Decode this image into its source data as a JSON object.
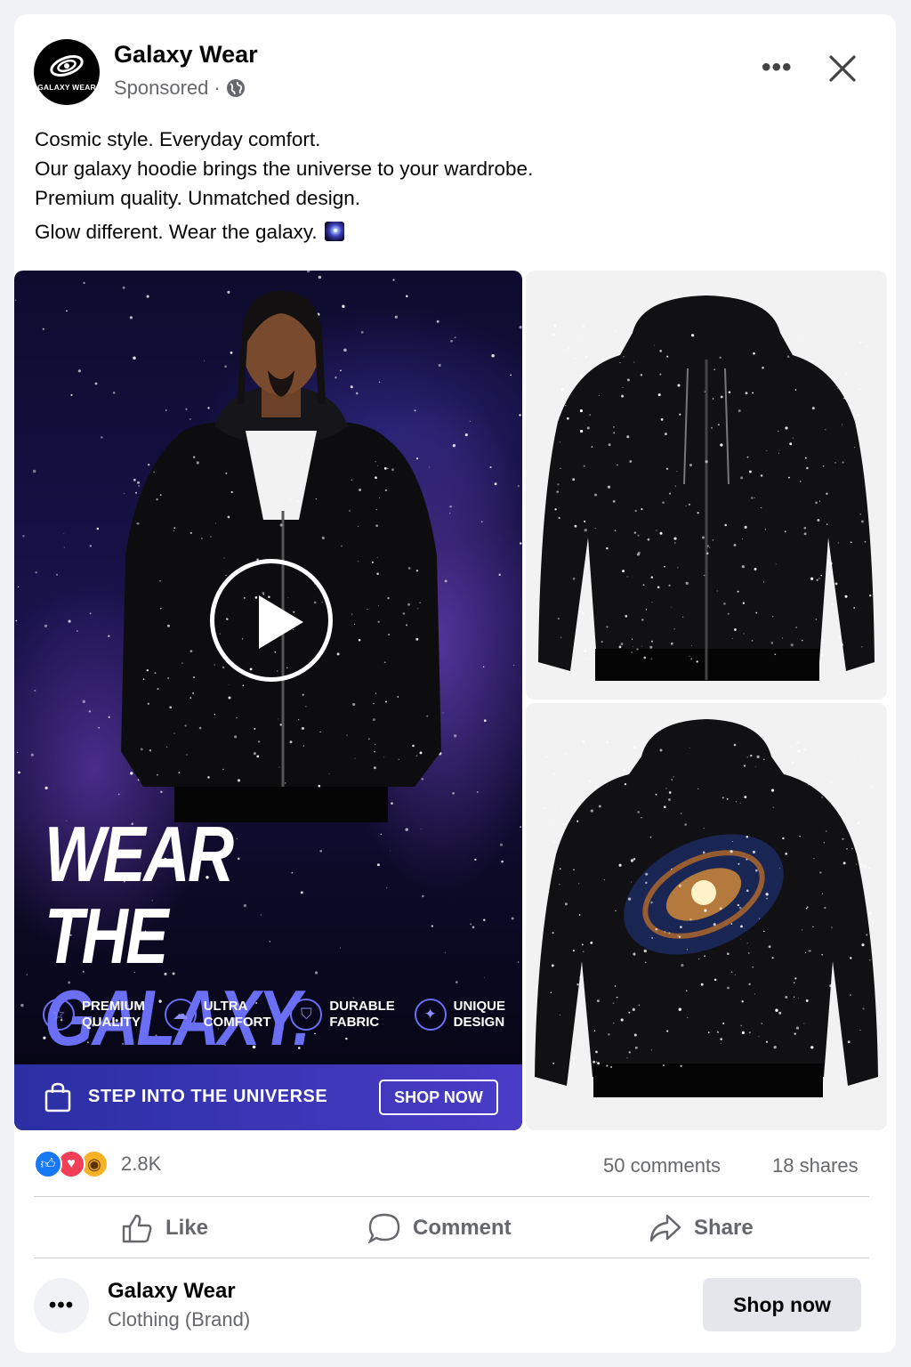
{
  "post": {
    "page_name": "Galaxy Wear",
    "sponsored_label": "Sponsored",
    "separator": "·",
    "logo_text": "GALAXY WEAR",
    "caption_lines": [
      "Cosmic style. Everyday comfort.",
      "Our galaxy hoodie brings the universe to your wardrobe.",
      "Premium quality. Unmatched design.",
      "Glow different. Wear the galaxy."
    ]
  },
  "creative": {
    "headline_line1": "WEAR",
    "headline_line2a": "THE ",
    "headline_line2b": "GALAXY.",
    "features": [
      {
        "label": "PREMIUM\nQUALITY",
        "icon": "star-icon"
      },
      {
        "label": "ULTRA\nCOMFORT",
        "icon": "cloud-icon"
      },
      {
        "label": "DURABLE\nFABRIC",
        "icon": "shield-icon"
      },
      {
        "label": "UNIQUE\nDESIGN",
        "icon": "sparkle-icon"
      }
    ],
    "cta_text": "STEP INTO THE UNIVERSE",
    "cta_button": "SHOP NOW",
    "accent_color": "#6a6ff5"
  },
  "stats": {
    "reaction_count": "2.8K",
    "comments": "50 comments",
    "shares": "18 shares",
    "reactions": [
      "like-icon",
      "love-icon",
      "wow-icon"
    ]
  },
  "actions": {
    "like": "Like",
    "comment": "Comment",
    "share": "Share"
  },
  "footer": {
    "name": "Galaxy Wear",
    "category": "Clothing (Brand)",
    "button": "Shop now"
  }
}
